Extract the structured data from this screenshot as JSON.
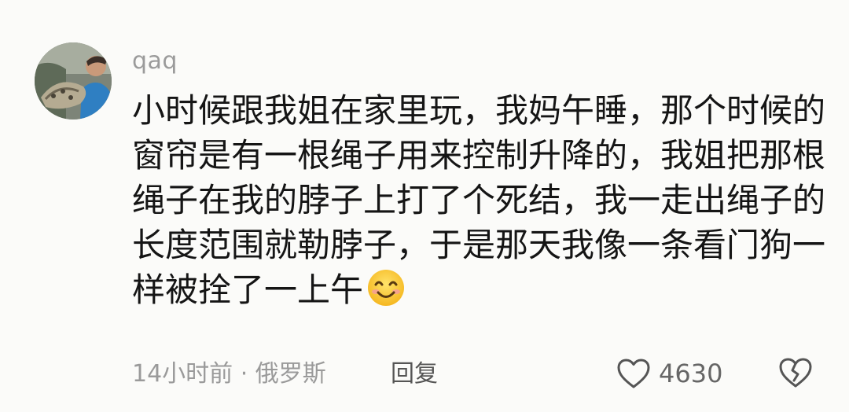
{
  "comment": {
    "avatar_icon": "user-avatar-photo",
    "username": "qaq",
    "text_lines": [
      "小时候跟我姐在家里玩，我妈午睡，那个时候的",
      "窗帘是有一根绳子用来控制升降的，我姐把那根",
      "绳子在我的脖子上打了个死结，我一走出绳子的",
      "长度范围就勒脖子，于是那天我像一条看门狗一",
      "样被拴了一上午"
    ],
    "emoji_icon": "smiling-face-emoji",
    "meta": "14小时前 · 俄罗斯",
    "reply_label": "回复",
    "like_icon": "heart-outline-icon",
    "like_count": "4630",
    "dislike_icon": "broken-heart-icon"
  },
  "colors": {
    "background": "#fbfbf9",
    "text": "#151515",
    "secondary": "#9a9a9a"
  }
}
